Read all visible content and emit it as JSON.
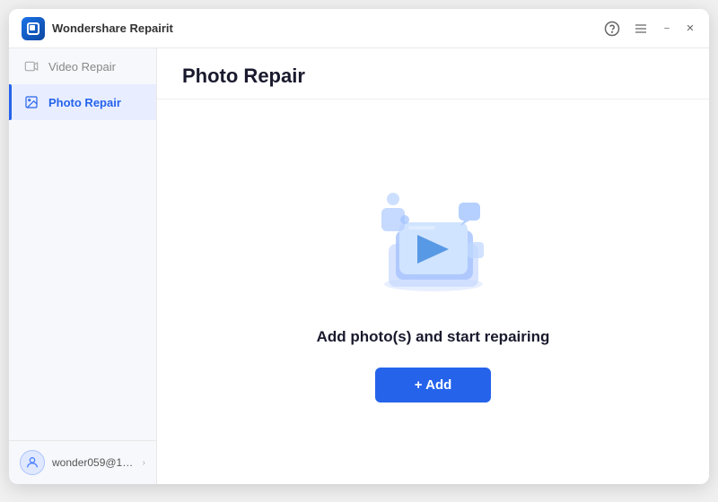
{
  "app": {
    "name": "Wondershare Repairit",
    "logo_alt": "Wondershare Repairit logo"
  },
  "titlebar": {
    "help_icon": "?",
    "menu_icon": "☰",
    "minimize_label": "−",
    "close_label": "✕"
  },
  "sidebar": {
    "items": [
      {
        "id": "video-repair",
        "label": "Video Repair",
        "icon": "video-icon",
        "active": false
      },
      {
        "id": "photo-repair",
        "label": "Photo Repair",
        "icon": "photo-icon",
        "active": true
      }
    ],
    "user": {
      "name": "wonder059@16...",
      "avatar_icon": "person-icon"
    }
  },
  "main": {
    "title": "Photo Repair",
    "empty_state_text": "Add photo(s) and start repairing",
    "add_button_label": "+ Add"
  }
}
